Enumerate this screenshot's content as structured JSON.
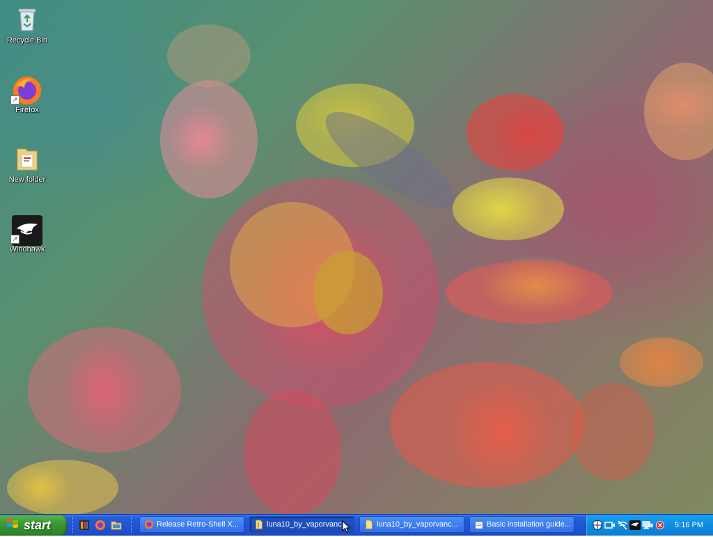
{
  "desktop": {
    "icons": [
      {
        "label": "Recycle Bin",
        "icon": "recycle-bin-icon"
      },
      {
        "label": "Firefox",
        "icon": "firefox-icon"
      },
      {
        "label": "New folder",
        "icon": "folder-icon"
      },
      {
        "label": "Windhawk",
        "icon": "windhawk-icon"
      }
    ]
  },
  "taskbar": {
    "start_label": "start",
    "quick_launch": [
      "app-icon",
      "firefox-icon",
      "explorer-icon"
    ],
    "tasks": [
      {
        "label": "Release Retro-Shell X...",
        "icon": "firefox-icon"
      },
      {
        "label": "luna10_by_vaporvanc...",
        "icon": "folder-icon",
        "active": true
      },
      {
        "label": "luna10_by_vaporvanc...",
        "icon": "folder-icon"
      },
      {
        "label": "Basic installation guide...",
        "icon": "notepad-icon"
      }
    ],
    "tray_icons": [
      "shield-icon",
      "video-icon",
      "wifi-off-icon",
      "eagle-icon",
      "network-icon",
      "volume-muted-icon"
    ],
    "clock": "5:16 PM"
  },
  "colors": {
    "taskbar_blue": "#245edb",
    "start_green": "#3d9a36",
    "tray_blue": "#0f8bdf"
  }
}
